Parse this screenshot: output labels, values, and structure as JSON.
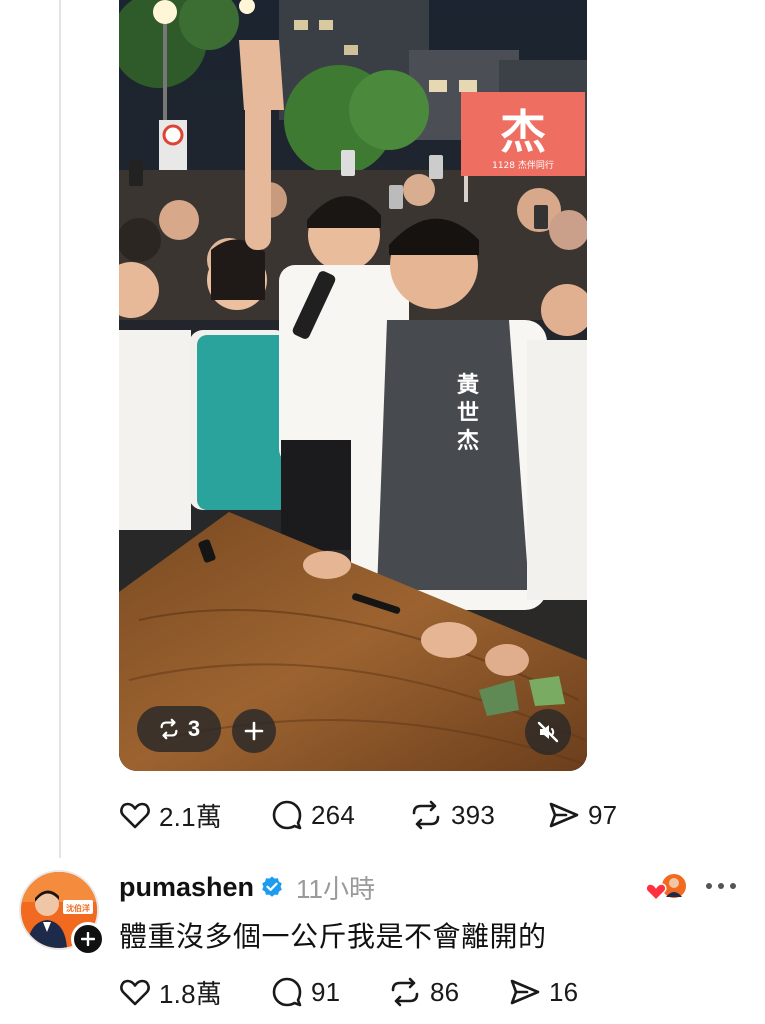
{
  "post": {
    "video": {
      "flag_char": "杰",
      "flag_sub": "1128 杰伴同行",
      "vest_name": "黃世杰",
      "repost_count": "3"
    },
    "stats": {
      "likes": "2.1萬",
      "comments": "264",
      "reposts": "393",
      "shares": "97"
    }
  },
  "reply": {
    "username": "pumashen",
    "verified": true,
    "time": "11小時",
    "text": "體重沒多個一公斤我是不會離開的",
    "avatar_caption": "沈伯洋",
    "stats": {
      "likes": "1.8萬",
      "comments": "91",
      "reposts": "86",
      "shares": "16"
    }
  },
  "colors": {
    "verified_blue": "#1d9bf0",
    "heart_red": "#ff3040",
    "flag_bg": "#ef6e62",
    "text_dark": "#101010",
    "text_muted": "#9a9a9a"
  },
  "icons": [
    "heart-icon",
    "comment-icon",
    "repost-icon",
    "share-icon",
    "mute-icon",
    "plus-icon",
    "more-icon",
    "verified-icon"
  ]
}
